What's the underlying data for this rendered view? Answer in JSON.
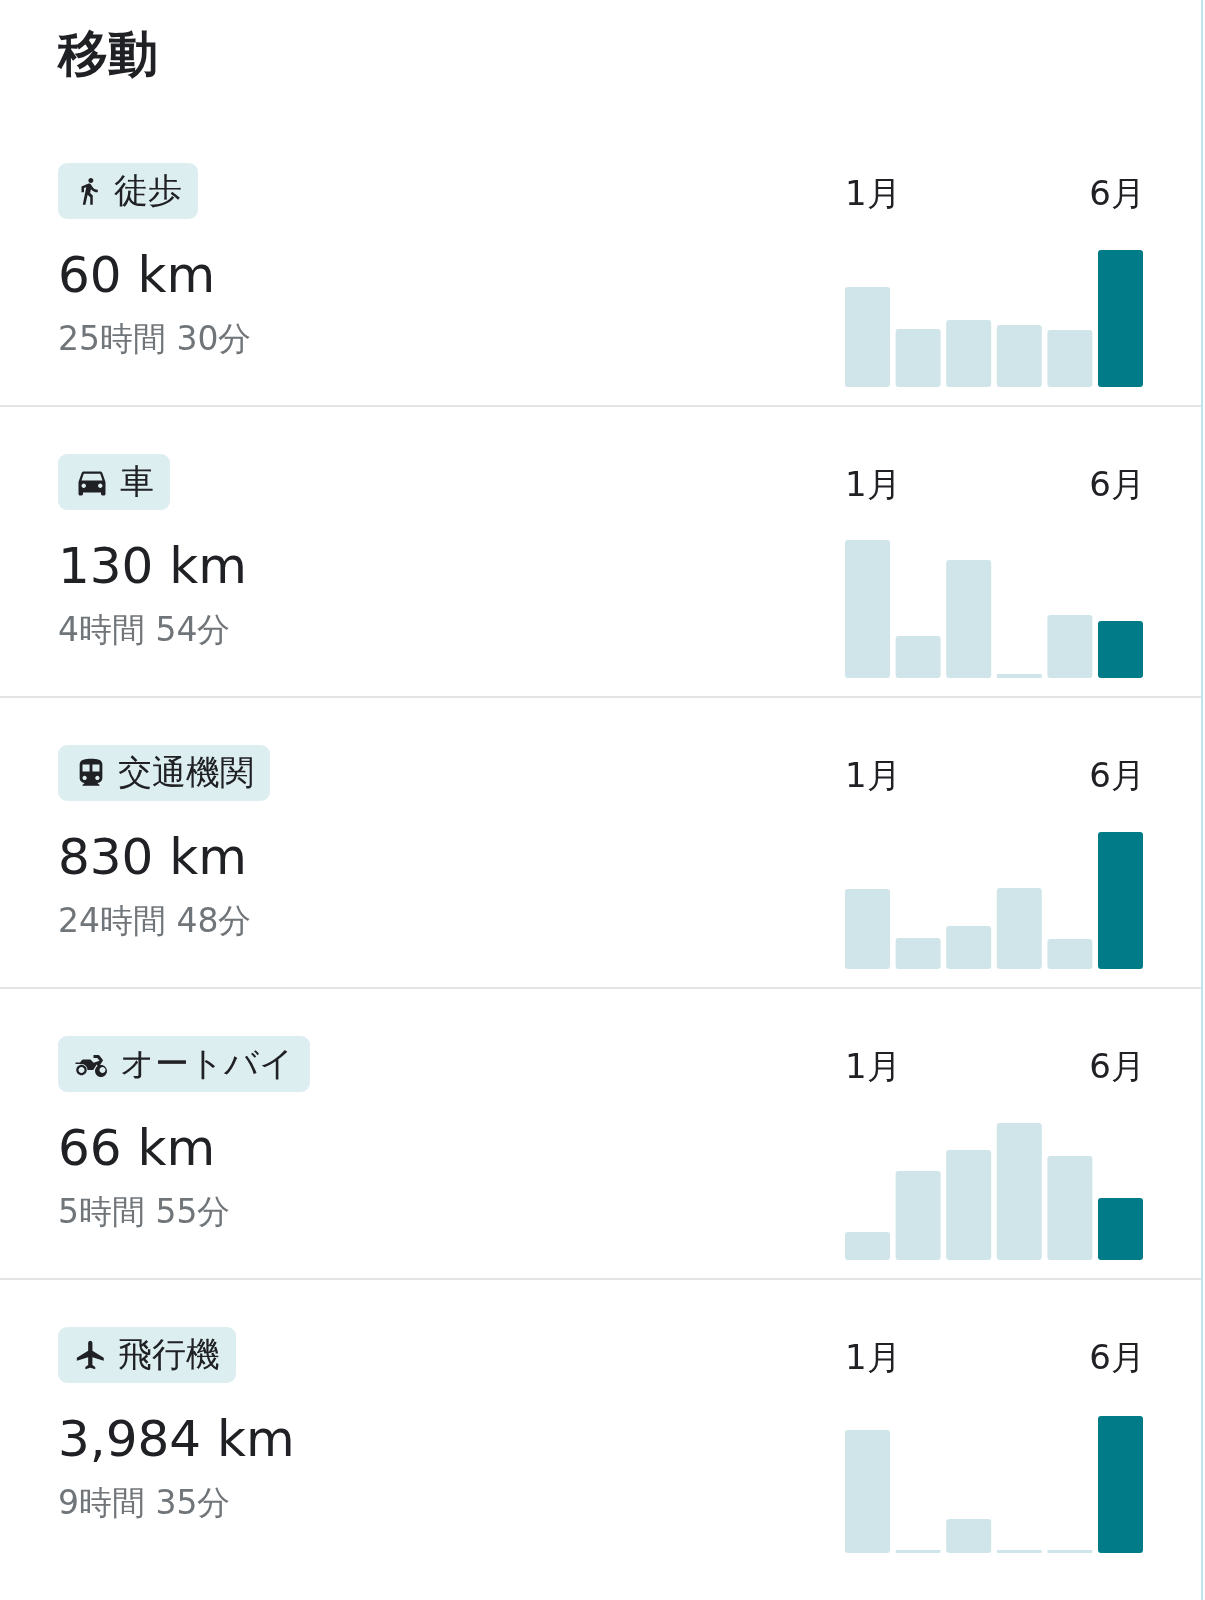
{
  "title": "移動",
  "modes": [
    {
      "kind": "walk",
      "label": "徒歩",
      "distance": "60 km",
      "duration": "25時間 30分",
      "month_start": "1月",
      "month_end": "6月"
    },
    {
      "kind": "car",
      "label": "車",
      "distance": "130 km",
      "duration": "4時間 54分",
      "month_start": "1月",
      "month_end": "6月"
    },
    {
      "kind": "transit",
      "label": "交通機関",
      "distance": "830 km",
      "duration": "24時間 48分",
      "month_start": "1月",
      "month_end": "6月"
    },
    {
      "kind": "motorcycle",
      "label": "オートバイ",
      "distance": "66 km",
      "duration": "5時間 55分",
      "month_start": "1月",
      "month_end": "6月"
    },
    {
      "kind": "plane",
      "label": "飛行機",
      "distance": "3,984 km",
      "duration": "9時間 35分",
      "month_start": "1月",
      "month_end": "6月"
    }
  ]
}
